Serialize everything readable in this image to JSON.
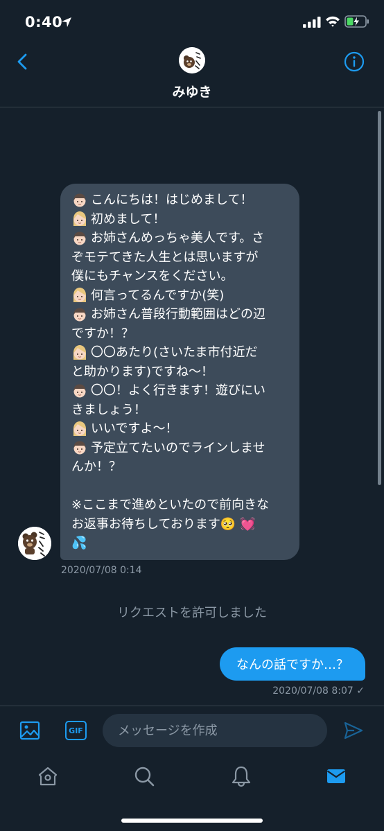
{
  "status_bar": {
    "time": "0:40",
    "icons": [
      "location-arrow-icon",
      "signal-icon",
      "wifi-icon",
      "battery-charging-icon"
    ]
  },
  "header": {
    "name": "みゆき",
    "back_icon": "chevron-left-icon",
    "info_icon": "info-icon",
    "accent": "#1d9bf0"
  },
  "incoming": {
    "lines": [
      {
        "speaker": "man",
        "text": "こんにちは！はじめまして！"
      },
      {
        "speaker": "woman",
        "text": "初めまして！"
      },
      {
        "speaker": "man",
        "text": "お姉さんめっちゃ美人です。さ"
      },
      {
        "speaker": "",
        "text": "ぞモテてきた人生とは思いますが"
      },
      {
        "speaker": "",
        "text": "僕にもチャンスをください。"
      },
      {
        "speaker": "woman",
        "text": "何言ってるんですか(笑)"
      },
      {
        "speaker": "man",
        "text": "お姉さん普段行動範囲はどの辺"
      },
      {
        "speaker": "",
        "text": "ですか！？"
      },
      {
        "speaker": "woman",
        "text": "〇〇あたり(さいたま市付近だ"
      },
      {
        "speaker": "",
        "text": "と助かります)ですね〜！"
      },
      {
        "speaker": "man",
        "text": "〇〇！よく行きます！遊びにい"
      },
      {
        "speaker": "",
        "text": "きましょう！"
      },
      {
        "speaker": "woman",
        "text": "いいですよ〜！"
      },
      {
        "speaker": "man",
        "text": "予定立てたいのでラインしませ"
      },
      {
        "speaker": "",
        "text": "んか！？"
      },
      {
        "speaker": "blank",
        "text": ""
      },
      {
        "speaker": "",
        "text": "※ここまで進めといたので前向きな"
      },
      {
        "speaker": "",
        "text": "お返事お待ちしております🥺 💓"
      },
      {
        "speaker": "",
        "text": "💦"
      }
    ],
    "timestamp": "2020/07/08 0:14"
  },
  "system_message": "リクエストを許可しました",
  "outgoing": {
    "text": "なんの話ですか…？",
    "timestamp": "2020/07/08 8:07 ✓"
  },
  "composer": {
    "placeholder": "メッセージを作成",
    "gif_label": "GIF",
    "icons": [
      "image-icon",
      "send-icon"
    ]
  },
  "tabbar": {
    "tabs": [
      "home-icon",
      "search-icon",
      "bell-icon",
      "mail-icon"
    ],
    "active": "mail-icon"
  }
}
